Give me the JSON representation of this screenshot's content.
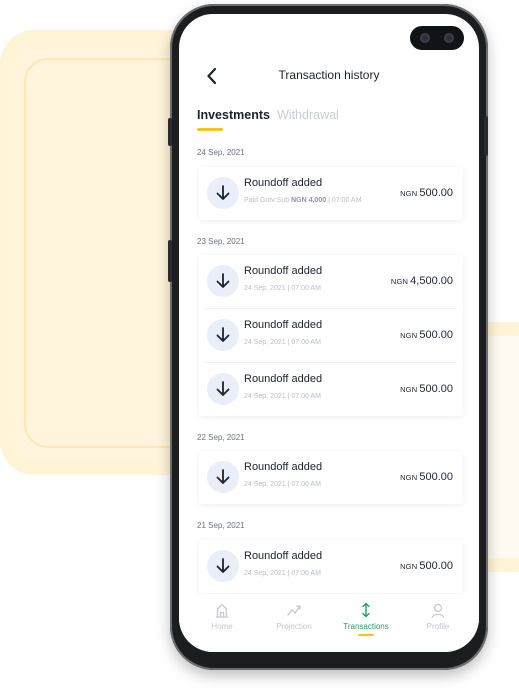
{
  "header": {
    "title": "Transaction history",
    "back_icon": "chevron-left-icon"
  },
  "tabs": [
    {
      "label": "Investments",
      "active": true
    },
    {
      "label": "Withdrawal",
      "active": false
    }
  ],
  "groups": [
    {
      "date": "24 Sep, 2021",
      "items": [
        {
          "title": "Roundoff added",
          "sub_prefix": "Paid Gotv Sub ",
          "sub_bold": "NGN 4,000",
          "sub_suffix": " | 07:00 AM",
          "currency": "NGN",
          "amount": "500.00",
          "icon": "arrow-down-icon"
        }
      ]
    },
    {
      "date": "23 Sep, 2021",
      "items": [
        {
          "title": "Roundoff added",
          "sub": "24 Sep, 2021 | 07:00 AM",
          "currency": "NGN",
          "amount": "4,500.00",
          "icon": "arrow-down-icon"
        },
        {
          "title": "Roundoff added",
          "sub": "24 Sep, 2021 | 07:00 AM",
          "currency": "NGN",
          "amount": "500.00",
          "icon": "arrow-down-icon"
        },
        {
          "title": "Roundoff added",
          "sub": "24 Sep, 2021 | 07:00 AM",
          "currency": "NGN",
          "amount": "500.00",
          "icon": "arrow-down-icon"
        }
      ]
    },
    {
      "date": "22 Sep, 2021",
      "items": [
        {
          "title": "Roundoff added",
          "sub": "24 Sep, 2021 | 07:00 AM",
          "currency": "NGN",
          "amount": "500.00",
          "icon": "arrow-down-icon"
        }
      ]
    },
    {
      "date": "21 Sep, 2021",
      "items": [
        {
          "title": "Roundoff added",
          "sub": "24 Sep, 2021 | 07:00 AM",
          "currency": "NGN",
          "amount": "500.00",
          "icon": "arrow-down-icon"
        }
      ]
    }
  ],
  "nav": [
    {
      "label": "Home",
      "icon": "home-icon",
      "active": false
    },
    {
      "label": "Projection",
      "icon": "projection-icon",
      "active": false
    },
    {
      "label": "Transactions",
      "icon": "transactions-icon",
      "active": true
    },
    {
      "label": "Profile",
      "icon": "profile-icon",
      "active": false
    }
  ],
  "colors": {
    "accent_yellow": "#f5c518",
    "active_green": "#1e9e6b",
    "icon_bg": "#e9eef9",
    "text_dark": "#1d2230",
    "text_muted": "#c5c8cf",
    "background_frame": "#fff5dc"
  }
}
